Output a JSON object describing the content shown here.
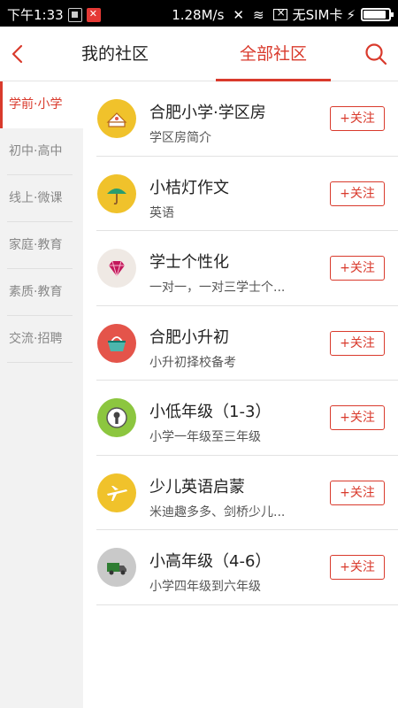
{
  "status_bar": {
    "time": "下午1:33",
    "speed": "1.28M/s",
    "carrier": "无SIM卡",
    "battery_level": 0.9
  },
  "header": {
    "tab_mine": "我的社区",
    "tab_all": "全部社区"
  },
  "sidebar": {
    "items": [
      {
        "label": "学前·小学"
      },
      {
        "label": "初中·高中"
      },
      {
        "label": "线上·微课"
      },
      {
        "label": "家庭·教育"
      },
      {
        "label": "素质·教育"
      },
      {
        "label": "交流·招聘"
      }
    ]
  },
  "communities": [
    {
      "title": "合肥小学·学区房",
      "subtitle": "学区房简介",
      "follow_label": "+关注",
      "icon": "house-icon",
      "color": "#f0c22b"
    },
    {
      "title": "小桔灯作文",
      "subtitle": "英语",
      "follow_label": "+关注",
      "icon": "umbrella-icon",
      "color": "#f0c22b"
    },
    {
      "title": "学士个性化",
      "subtitle": "一对一，一对三学士个...",
      "follow_label": "+关注",
      "icon": "diamond-icon",
      "color": "#efe9e4"
    },
    {
      "title": "合肥小升初",
      "subtitle": "小升初择校备考",
      "follow_label": "+关注",
      "icon": "basket-icon",
      "color": "#e4544a"
    },
    {
      "title": "小低年级（1-3）",
      "subtitle": "小学一年级至三年级",
      "follow_label": "+关注",
      "icon": "keyhole-icon",
      "color": "#8cc63f"
    },
    {
      "title": "少儿英语启蒙",
      "subtitle": "米迪趣多多、剑桥少儿...",
      "follow_label": "+关注",
      "icon": "airplane-icon",
      "color": "#f0c22b"
    },
    {
      "title": "小高年级（4-6）",
      "subtitle": "小学四年级到六年级",
      "follow_label": "+关注",
      "icon": "truck-icon",
      "color": "#c9c9c9"
    }
  ],
  "colors": {
    "accent": "#d93a2c",
    "sidebar_bg": "#f2f2f2"
  }
}
